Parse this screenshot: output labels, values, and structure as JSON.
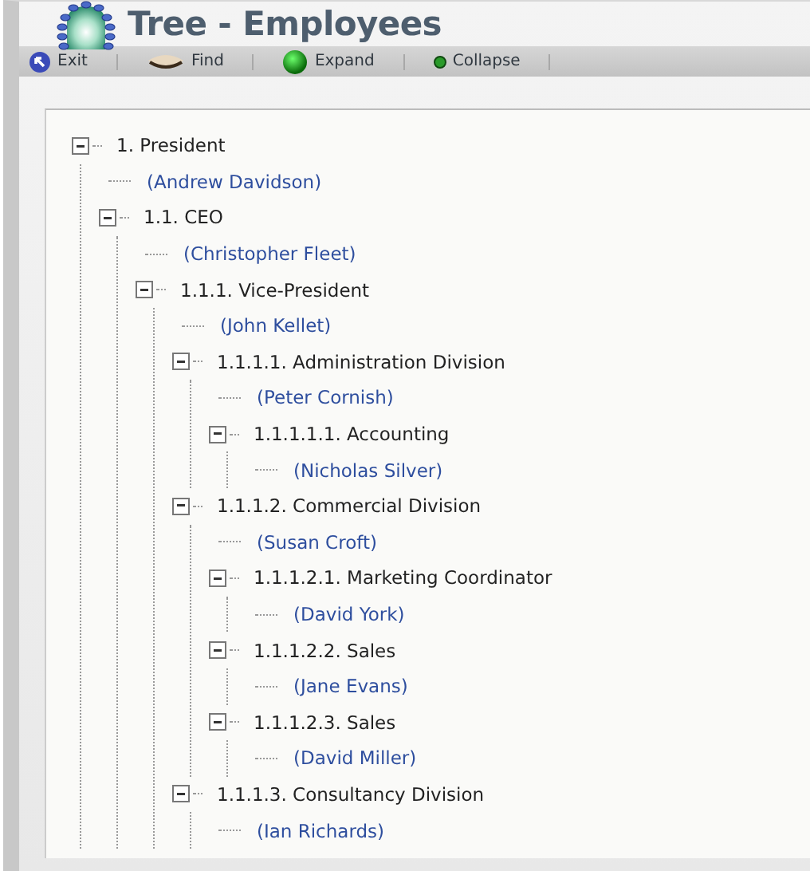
{
  "window": {
    "title": "Tree - Employees"
  },
  "toolbar": [
    {
      "kind": "exit",
      "label": "Exit"
    },
    {
      "kind": "find",
      "label": "Find"
    },
    {
      "kind": "expand",
      "label": "Expand"
    },
    {
      "kind": "collapse",
      "label": "Collapse"
    }
  ],
  "tree": [
    {
      "kind": "position",
      "label": "1. President",
      "expanded": true,
      "children": [
        {
          "kind": "person",
          "label": "(Andrew Davidson)"
        },
        {
          "kind": "position",
          "label": "1.1. CEO",
          "expanded": true,
          "children": [
            {
              "kind": "person",
              "label": "(Christopher Fleet)"
            },
            {
              "kind": "position",
              "label": "1.1.1. Vice-President",
              "expanded": true,
              "children": [
                {
                  "kind": "person",
                  "label": "(John Kellet)"
                },
                {
                  "kind": "position",
                  "label": "1.1.1.1. Administration Division",
                  "expanded": true,
                  "children": [
                    {
                      "kind": "person",
                      "label": "(Peter Cornish)"
                    },
                    {
                      "kind": "position",
                      "label": "1.1.1.1.1. Accounting",
                      "expanded": true,
                      "children": [
                        {
                          "kind": "person",
                          "label": "(Nicholas Silver)"
                        }
                      ]
                    }
                  ]
                },
                {
                  "kind": "position",
                  "label": "1.1.1.2. Commercial Division",
                  "expanded": true,
                  "children": [
                    {
                      "kind": "person",
                      "label": "(Susan Croft)"
                    },
                    {
                      "kind": "position",
                      "label": "1.1.1.2.1. Marketing Coordinator",
                      "expanded": true,
                      "children": [
                        {
                          "kind": "person",
                          "label": "(David York)"
                        }
                      ]
                    },
                    {
                      "kind": "position",
                      "label": "1.1.1.2.2. Sales",
                      "expanded": true,
                      "children": [
                        {
                          "kind": "person",
                          "label": "(Jane Evans)"
                        }
                      ]
                    },
                    {
                      "kind": "position",
                      "label": "1.1.1.2.3. Sales",
                      "expanded": true,
                      "children": [
                        {
                          "kind": "person",
                          "label": "(David Miller)"
                        }
                      ]
                    }
                  ]
                },
                {
                  "kind": "position",
                  "label": "1.1.1.3. Consultancy Division",
                  "expanded": true,
                  "children": [
                    {
                      "kind": "person",
                      "label": "(Ian Richards)"
                    }
                  ]
                }
              ]
            }
          ]
        }
      ]
    }
  ]
}
